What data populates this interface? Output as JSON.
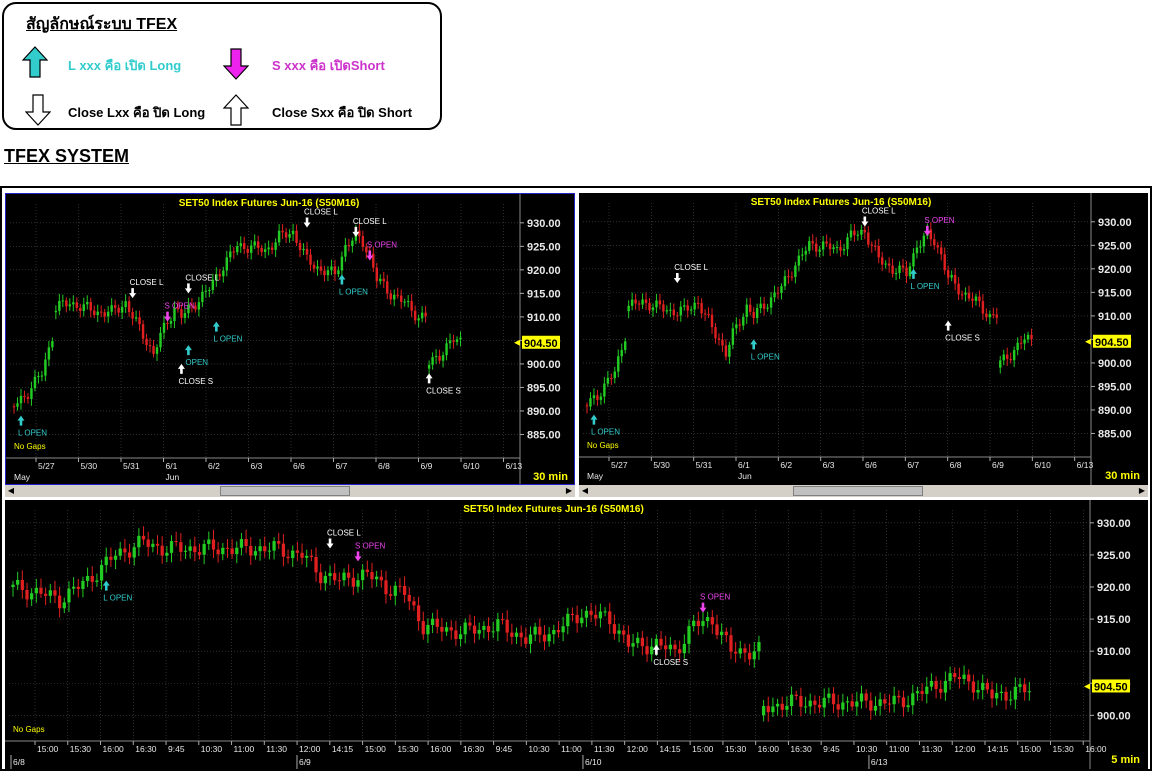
{
  "legend": {
    "title": "สัญลักษณ์ระบบ TFEX",
    "items": [
      {
        "text": "L xxx คือ เปิด Long",
        "color": "#33cccc"
      },
      {
        "text": "S xxx คือ เปิดShort",
        "color": "#cc33cc"
      },
      {
        "text": "Close Lxx คือ ปิด Long",
        "color": "#000000"
      },
      {
        "text": "Close Sxx คือ ปิด Short",
        "color": "#000000"
      }
    ]
  },
  "system_title": "TFEX SYSTEM",
  "colors": {
    "up": "#22cc22",
    "down": "#e02020",
    "grid": "#4a4a4a",
    "buy": "#33cccc",
    "sell": "#ee44ee",
    "close": "#ffffff",
    "title": "#ffff00",
    "price_box": "#ffff00"
  },
  "chart_data": [
    {
      "type": "candlestick",
      "title": "SET50  Index  Futures  Jun-16  (S50M16)",
      "interval": "30  min",
      "gap_label": "No  Gaps",
      "ylim": [
        880,
        934
      ],
      "yticks": [
        "930.00",
        "925.00",
        "920.00",
        "915.00",
        "910.00",
        "905.00",
        "900.00",
        "895.00",
        "890.00",
        "885.00"
      ],
      "ytick_values": [
        930,
        925,
        920,
        915,
        910,
        905,
        900,
        895,
        890,
        885
      ],
      "last_price": "904.50",
      "last_value": 904.5,
      "xticks": [
        "5/27",
        "5/30",
        "5/31",
        "6/1",
        "6/2",
        "6/3",
        "6/6",
        "6/7",
        "6/8",
        "6/9",
        "6/10",
        "6/13"
      ],
      "months": [
        "May",
        "Jun"
      ],
      "path": [
        [
          0,
          891
        ],
        [
          4,
          894
        ],
        [
          8,
          898
        ],
        [
          11,
          906
        ],
        [
          12,
          912
        ],
        [
          16,
          913
        ],
        [
          20,
          912
        ],
        [
          24,
          911
        ],
        [
          28,
          911
        ],
        [
          32,
          913
        ],
        [
          34,
          910
        ],
        [
          38,
          905
        ],
        [
          40,
          902
        ],
        [
          42,
          906
        ],
        [
          44,
          909
        ],
        [
          46,
          912
        ],
        [
          48,
          910
        ],
        [
          52,
          913
        ],
        [
          56,
          916
        ],
        [
          60,
          921
        ],
        [
          64,
          925
        ],
        [
          68,
          925
        ],
        [
          72,
          924
        ],
        [
          76,
          927
        ],
        [
          80,
          928
        ],
        [
          84,
          922
        ],
        [
          88,
          920
        ],
        [
          92,
          919
        ],
        [
          95,
          925
        ],
        [
          98,
          927
        ],
        [
          100,
          926
        ],
        [
          102,
          923
        ],
        [
          104,
          918
        ],
        [
          108,
          915
        ],
        [
          112,
          913
        ],
        [
          116,
          910
        ],
        [
          118,
          910
        ],
        [
          119,
          900
        ],
        [
          122,
          902
        ],
        [
          126,
          905
        ],
        [
          128,
          905
        ]
      ],
      "signals": [
        {
          "i": 2,
          "v": 889,
          "kind": "buy",
          "label": "L  OPEN"
        },
        {
          "i": 34,
          "v": 914,
          "kind": "close",
          "label": "CLOSE  L"
        },
        {
          "i": 44,
          "v": 909,
          "kind": "sell",
          "label": "S  OPEN"
        },
        {
          "i": 50,
          "v": 915,
          "kind": "close",
          "label": "CLOSE  L"
        },
        {
          "i": 50,
          "v": 904,
          "kind": "buy",
          "label": "OPEN"
        },
        {
          "i": 48,
          "v": 900,
          "kind": "closeUp",
          "label": "CLOSE  S"
        },
        {
          "i": 58,
          "v": 909,
          "kind": "buy",
          "label": "L  OPEN"
        },
        {
          "i": 84,
          "v": 929,
          "kind": "close",
          "label": "CLOSE  L"
        },
        {
          "i": 94,
          "v": 919,
          "kind": "buy",
          "label": "L  OPEN"
        },
        {
          "i": 98,
          "v": 927,
          "kind": "close",
          "label": "CLOSE  L"
        },
        {
          "i": 102,
          "v": 922,
          "kind": "sell",
          "label": "S  OPEN"
        },
        {
          "i": 119,
          "v": 898,
          "kind": "closeUp",
          "label": "CLOSE  S"
        }
      ]
    },
    {
      "type": "candlestick",
      "title": "SET50  Index  Futures  Jun-16  (S50M16)",
      "interval": "30  min",
      "gap_label": "No  Gaps",
      "ylim": [
        880,
        934
      ],
      "yticks": [
        "930.00",
        "925.00",
        "920.00",
        "915.00",
        "910.00",
        "905.00",
        "900.00",
        "895.00",
        "890.00",
        "885.00"
      ],
      "ytick_values": [
        930,
        925,
        920,
        915,
        910,
        905,
        900,
        895,
        890,
        885
      ],
      "last_price": "904.50",
      "last_value": 904.5,
      "xticks": [
        "5/27",
        "5/30",
        "5/31",
        "6/1",
        "6/2",
        "6/3",
        "6/6",
        "6/7",
        "6/8",
        "6/9",
        "6/10",
        "6/13"
      ],
      "months": [
        "May",
        "Jun"
      ],
      "path": [
        [
          0,
          891
        ],
        [
          4,
          894
        ],
        [
          8,
          898
        ],
        [
          11,
          906
        ],
        [
          12,
          912
        ],
        [
          16,
          913
        ],
        [
          20,
          912
        ],
        [
          24,
          911
        ],
        [
          28,
          911
        ],
        [
          32,
          913
        ],
        [
          34,
          910
        ],
        [
          38,
          905
        ],
        [
          40,
          902
        ],
        [
          42,
          906
        ],
        [
          44,
          909
        ],
        [
          46,
          912
        ],
        [
          48,
          910
        ],
        [
          52,
          913
        ],
        [
          56,
          916
        ],
        [
          60,
          921
        ],
        [
          64,
          925
        ],
        [
          68,
          925
        ],
        [
          72,
          924
        ],
        [
          76,
          927
        ],
        [
          80,
          928
        ],
        [
          84,
          922
        ],
        [
          88,
          920
        ],
        [
          92,
          919
        ],
        [
          95,
          925
        ],
        [
          98,
          927
        ],
        [
          100,
          926
        ],
        [
          102,
          923
        ],
        [
          104,
          918
        ],
        [
          108,
          915
        ],
        [
          112,
          913
        ],
        [
          116,
          910
        ],
        [
          118,
          910
        ],
        [
          119,
          900
        ],
        [
          122,
          902
        ],
        [
          126,
          905
        ],
        [
          128,
          905
        ]
      ],
      "signals": [
        {
          "i": 2,
          "v": 889,
          "kind": "buy",
          "label": "L  OPEN"
        },
        {
          "i": 26,
          "v": 917,
          "kind": "close",
          "label": "CLOSE  L"
        },
        {
          "i": 48,
          "v": 905,
          "kind": "buy",
          "label": "L  OPEN"
        },
        {
          "i": 80,
          "v": 929,
          "kind": "close",
          "label": "CLOSE  L"
        },
        {
          "i": 94,
          "v": 920,
          "kind": "buy",
          "label": "L  OPEN"
        },
        {
          "i": 98,
          "v": 927,
          "kind": "sell",
          "label": "S  OPEN"
        },
        {
          "i": 104,
          "v": 909,
          "kind": "closeUp",
          "label": "CLOSE  S"
        }
      ]
    },
    {
      "type": "candlestick",
      "title": "SET50  Index  Futures  Jun-16  (S50M16)",
      "interval": "5  min",
      "gap_label": "No  Gaps",
      "ylim": [
        896,
        932
      ],
      "yticks": [
        "930.00",
        "925.00",
        "920.00",
        "915.00",
        "910.00",
        "905.00",
        "900.00"
      ],
      "ytick_values": [
        930,
        925,
        920,
        915,
        910,
        905,
        900
      ],
      "last_price": "904.50",
      "last_value": 904.5,
      "xticks": [
        "15:00",
        "15:30",
        "16:00",
        "16:30",
        "9:45",
        "10:30",
        "11:00",
        "11:30",
        "12:00",
        "14:15",
        "15:00",
        "15:30",
        "16:00",
        "16:30",
        "9:45",
        "10:30",
        "11:00",
        "11:30",
        "12:00",
        "14:15",
        "15:00",
        "15:30",
        "16:00",
        "16:30",
        "9:45",
        "10:30",
        "11:00",
        "11:30",
        "12:00",
        "14:15",
        "15:00",
        "15:30",
        "16:00"
      ],
      "dates": [
        "6/8",
        "6/9",
        "6/10",
        "6/13"
      ],
      "path": [
        [
          0,
          920
        ],
        [
          6,
          919
        ],
        [
          10,
          918
        ],
        [
          16,
          921
        ],
        [
          22,
          925
        ],
        [
          28,
          927
        ],
        [
          32,
          926
        ],
        [
          40,
          926
        ],
        [
          48,
          926
        ],
        [
          56,
          926
        ],
        [
          62,
          925
        ],
        [
          66,
          922
        ],
        [
          70,
          921
        ],
        [
          76,
          922
        ],
        [
          80,
          920
        ],
        [
          84,
          919
        ],
        [
          88,
          914
        ],
        [
          96,
          913
        ],
        [
          104,
          914
        ],
        [
          110,
          912
        ],
        [
          116,
          913
        ],
        [
          122,
          916
        ],
        [
          128,
          915
        ],
        [
          132,
          911
        ],
        [
          138,
          911
        ],
        [
          142,
          910
        ],
        [
          146,
          914
        ],
        [
          150,
          915
        ],
        [
          154,
          910
        ],
        [
          160,
          910
        ],
        [
          161,
          901
        ],
        [
          166,
          902
        ],
        [
          172,
          902
        ],
        [
          178,
          902
        ],
        [
          184,
          902
        ],
        [
          190,
          902
        ],
        [
          196,
          904
        ],
        [
          202,
          906
        ],
        [
          206,
          905
        ],
        [
          210,
          903
        ],
        [
          218,
          904
        ]
      ],
      "signals": [
        {
          "i": 20,
          "v": 921,
          "kind": "buy",
          "label": "L  OPEN"
        },
        {
          "i": 68,
          "v": 926,
          "kind": "close",
          "label": "CLOSE  L"
        },
        {
          "i": 74,
          "v": 924,
          "kind": "sell",
          "label": "S  OPEN"
        },
        {
          "i": 138,
          "v": 911,
          "kind": "closeUp",
          "label": "CLOSE  S"
        },
        {
          "i": 148,
          "v": 916,
          "kind": "sell",
          "label": "S  OPEN"
        }
      ]
    }
  ]
}
